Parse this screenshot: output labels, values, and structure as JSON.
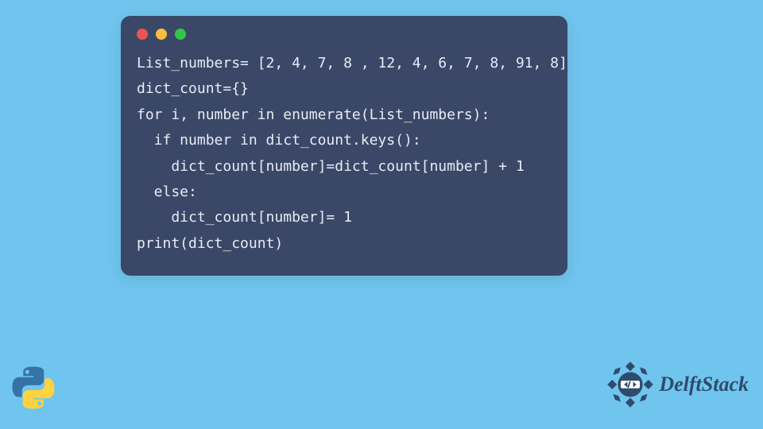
{
  "code": {
    "lines": [
      "List_numbers= [2, 4, 7, 8 , 12, 4, 6, 7, 8, 91, 8]",
      "dict_count={}",
      "for i, number in enumerate(List_numbers):",
      "  if number in dict_count.keys():",
      "    dict_count[number]=dict_count[number] + 1",
      "  else:",
      "    dict_count[number]= 1",
      "print(dict_count)"
    ]
  },
  "brand": {
    "name": "DelftStack"
  },
  "colors": {
    "background": "#70c5ee",
    "window": "#3a4767",
    "text": "#e8ecf4",
    "brand": "#2e4c6d"
  }
}
